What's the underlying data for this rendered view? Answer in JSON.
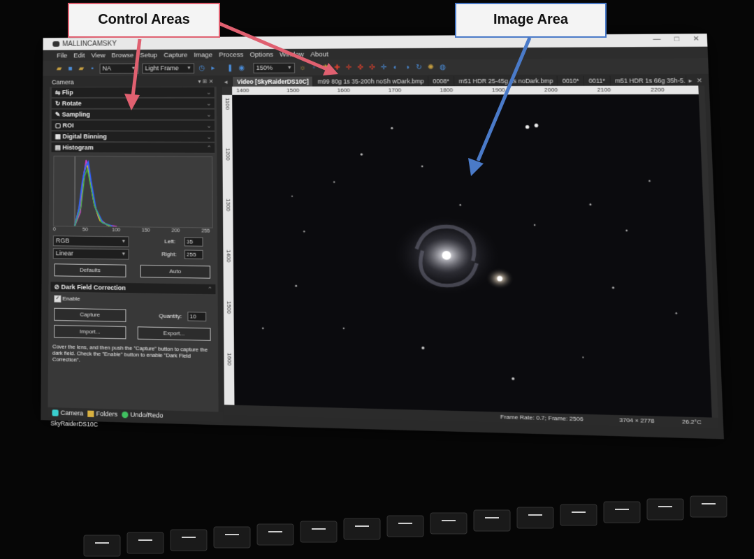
{
  "annotations": {
    "control": {
      "label": "Control Areas",
      "color": "#e06070"
    },
    "image": {
      "label": "Image Area",
      "color": "#4a7ac8"
    }
  },
  "window": {
    "app_title": "MALLINCAMSKY",
    "min": "—",
    "max": "□",
    "close": "✕"
  },
  "menu": [
    "File",
    "Edit",
    "View",
    "Browse",
    "Setup",
    "Capture",
    "Image",
    "Process",
    "Options",
    "Window",
    "About"
  ],
  "toolbar": {
    "camera_select": "NA",
    "frame_type": "Light Frame",
    "zoom": "150%"
  },
  "left_panel": {
    "header": "Camera",
    "header_controls": "▾ ⊞ ✕",
    "sections": [
      {
        "label": "Flip",
        "icon": "flip-icon"
      },
      {
        "label": "Rotate",
        "icon": "rotate-icon"
      },
      {
        "label": "Sampling",
        "icon": "sampling-icon"
      },
      {
        "label": "ROI",
        "icon": "roi-icon"
      },
      {
        "label": "Digital Binning",
        "icon": "binning-icon"
      },
      {
        "label": "Histogram",
        "icon": "histogram-icon"
      }
    ],
    "histogram": {
      "ticks": [
        "0",
        "50",
        "100",
        "150",
        "200",
        "255"
      ],
      "channel_select": "RGB",
      "curve_select": "Linear",
      "left_label": "Left:",
      "left_value": "35",
      "right_label": "Right:",
      "right_value": "255",
      "defaults_button": "Defaults",
      "auto_button": "Auto"
    },
    "dark_field": {
      "title": "Dark Field Correction",
      "enable_label": "Enable",
      "enabled": true,
      "capture_button": "Capture",
      "quantity_label": "Quantity:",
      "quantity_value": "10",
      "import_button": "Import...",
      "export_button": "Export...",
      "help_text": "Cover the lens, and then push the \"Capture\" button to capture the dark field. Check the \"Enable\" button to enable \"Dark Field Correction\"."
    },
    "bottom_tabs": [
      "Camera",
      "Folders",
      "Undo/Redo"
    ],
    "camera_name": "SkyRaiderDS10C"
  },
  "tabs": [
    {
      "label": "Video [SkyRaiderDS10C]",
      "active": true
    },
    {
      "label": "m99 80g 1s 35-200h noSh wDark.bmp",
      "active": false
    },
    {
      "label": "0008*",
      "active": false
    },
    {
      "label": "m51 HDR 25-45g 1s noDark.bmp",
      "active": false
    },
    {
      "label": "0010*",
      "active": false
    },
    {
      "label": "0011*",
      "active": false
    },
    {
      "label": "m51 HDR 1s 66g 35h-5...",
      "active": false
    }
  ],
  "ruler": {
    "top": [
      "1400",
      "1500",
      "1600",
      "1700",
      "1800",
      "1900",
      "2000",
      "2100",
      "2200"
    ],
    "left": [
      "1100",
      "1200",
      "1300",
      "1400",
      "1500",
      "1600"
    ]
  },
  "status": {
    "frame_info": "Frame Rate: 0.7; Frame: 2506",
    "resolution": "3704 × 2778",
    "temperature": "26.2°C"
  }
}
